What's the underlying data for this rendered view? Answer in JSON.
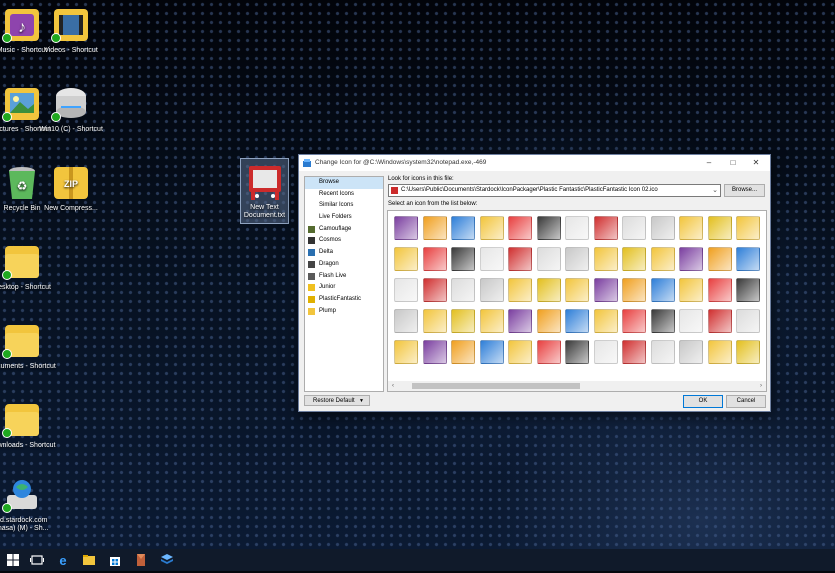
{
  "desktop": {
    "icons": [
      {
        "label": "Music - Shortcut"
      },
      {
        "label": "Videos - Shortcut"
      },
      {
        "label": "Pictures - Shortcut"
      },
      {
        "label": "Win10 (C) - Shortcut"
      },
      {
        "label": "Recycle Bin"
      },
      {
        "label": "New Compress..."
      },
      {
        "label": "Desktop - Shortcut"
      },
      {
        "label": "Documents - Shortcut"
      },
      {
        "label": "Downloads - Shortcut"
      },
      {
        "label": "sd.stardock.com (nasa) (M) - Sh..."
      },
      {
        "label": "New Text Document.txt"
      }
    ]
  },
  "dialog": {
    "title": "Change Icon for @C:\\Windows\\system32\\notepad.exe,-469",
    "sidebar_items": [
      {
        "label": "Browse",
        "icon": "none"
      },
      {
        "label": "Recent Icons",
        "icon": "none"
      },
      {
        "label": "Similar Icons",
        "icon": "none"
      },
      {
        "label": "Live Folders",
        "icon": "none"
      },
      {
        "label": "Camouflage",
        "icon": "camouflage-icon"
      },
      {
        "label": "Cosmos",
        "icon": "cosmos-icon"
      },
      {
        "label": "Delta",
        "icon": "delta-icon"
      },
      {
        "label": "Dragon",
        "icon": "dragon-icon"
      },
      {
        "label": "Flash Live",
        "icon": "flash-live-icon"
      },
      {
        "label": "Junior",
        "icon": "junior-icon"
      },
      {
        "label": "PlasticFantastic",
        "icon": "plasticfantastic-icon"
      },
      {
        "label": "Plump",
        "icon": "plump-icon"
      }
    ],
    "look_label": "Look for icons in this file:",
    "path_value": "C:\\Users\\Public\\Documents\\Stardock\\IconPackager\\Plastic Fantastic\\PlasticFantastic Icon 02.ico",
    "browse_label": "Browse...",
    "select_label": "Select an icon from the list below:",
    "restore_label": "Restore Default",
    "ok_label": "OK",
    "cancel_label": "Cancel"
  },
  "colors": {
    "accent": "#0078d7",
    "selection": "#cce4f7",
    "folder": "#f2c53d"
  }
}
